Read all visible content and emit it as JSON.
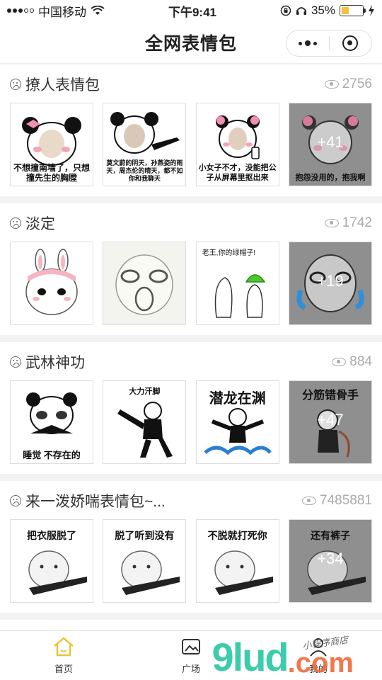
{
  "status": {
    "carrier": "中国移动",
    "time": "下午9:41",
    "battery": "35%",
    "battery_level": 0.35
  },
  "nav": {
    "title": "全网表情包"
  },
  "sections": [
    {
      "title": "撩人表情包",
      "views": "2756",
      "tiles": [
        {
          "caption": "不想撞南墙了，只想撞先生的胸膛"
        },
        {
          "caption": "莫文蔚的阴天，孙燕姿的雨天，周杰伦的晴天，都不如你和我聊天"
        },
        {
          "caption": "小女子不才，没能把公子从屏幕里抠出来"
        },
        {
          "caption": "抱怨没用的，抱我啊",
          "more": "+41"
        }
      ]
    },
    {
      "title": "淡定",
      "views": "1742",
      "tiles": [
        {
          "caption": ""
        },
        {
          "caption": ""
        },
        {
          "caption": "老王,你的绿帽子!"
        },
        {
          "caption": "",
          "more": "+19"
        }
      ]
    },
    {
      "title": "武林神功",
      "views": "884",
      "tiles": [
        {
          "caption": "睡觉 不存在的"
        },
        {
          "caption": "大力汗脚"
        },
        {
          "caption": "潜龙在渊"
        },
        {
          "caption": "分筋错骨手",
          "more": "+47"
        }
      ]
    },
    {
      "title": "来一泼娇喘表情包~...",
      "views": "7485881",
      "tiles": [
        {
          "caption": "把衣服脱了"
        },
        {
          "caption": "脱了听到没有"
        },
        {
          "caption": "不脱就打死你"
        },
        {
          "caption": "还有裤子",
          "more": "+34"
        }
      ]
    }
  ],
  "tabs": [
    {
      "label": "首页",
      "icon": "home-icon"
    },
    {
      "label": "广场",
      "icon": "square-icon"
    },
    {
      "label": "我的",
      "icon": "user-icon"
    }
  ],
  "watermark": {
    "big": "9lud",
    "com": ".com",
    "shop": "小程序商店"
  }
}
